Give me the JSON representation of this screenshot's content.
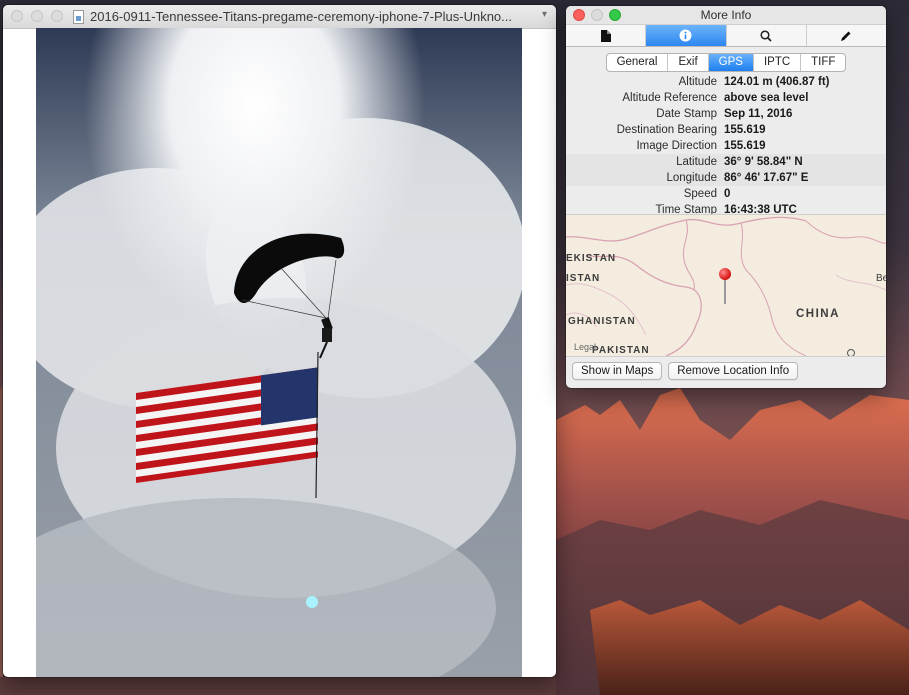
{
  "preview_window": {
    "title": "2016-0911-Tennessee-Titans-pregame-ceremony-iphone-7-Plus-Unkno...",
    "title_chevron_icon": "chevron-down-icon"
  },
  "info_window": {
    "title": "More Info",
    "toolbar_tabs": [
      {
        "icon": "document-icon",
        "active": false
      },
      {
        "icon": "info-icon",
        "active": true
      },
      {
        "icon": "search-icon",
        "active": false
      },
      {
        "icon": "pencil-icon",
        "active": false
      }
    ],
    "segments": [
      {
        "label": "General",
        "active": false
      },
      {
        "label": "Exif",
        "active": false
      },
      {
        "label": "GPS",
        "active": true
      },
      {
        "label": "IPTC",
        "active": false
      },
      {
        "label": "TIFF",
        "active": false
      }
    ],
    "gps": [
      {
        "key": "Altitude",
        "value": "124.01 m (406.87 ft)"
      },
      {
        "key": "Altitude Reference",
        "value": "above sea level"
      },
      {
        "key": "Date Stamp",
        "value": "Sep 11, 2016"
      },
      {
        "key": "Destination Bearing",
        "value": "155.619"
      },
      {
        "key": "Image Direction",
        "value": "155.619"
      },
      {
        "key": "Latitude",
        "value": "36° 9' 58.84\" N"
      },
      {
        "key": "Longitude",
        "value": "86° 46' 17.67\" E"
      },
      {
        "key": "Speed",
        "value": "0"
      },
      {
        "key": "Time Stamp",
        "value": "16:43:38 UTC"
      }
    ],
    "map": {
      "labels": [
        "EKISTAN",
        "ISTAN",
        "GHANISTAN",
        "PAKISTAN",
        "CHINA",
        "Be"
      ],
      "legal": "Legal"
    },
    "buttons": {
      "show_in_maps": "Show in Maps",
      "remove_location": "Remove Location Info"
    }
  },
  "colors": {
    "accent": "#2c87f0",
    "pin": "#d41010",
    "close": "#fc605c",
    "minimize": "#fdbc40",
    "maximize": "#34c84a"
  }
}
